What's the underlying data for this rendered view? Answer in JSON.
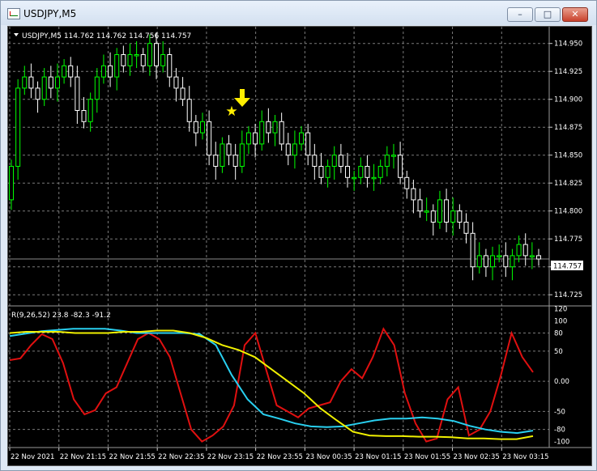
{
  "window": {
    "title": "USDJPY,M5",
    "minimize": "–",
    "maximize": "□",
    "close": "✕"
  },
  "main_panel": {
    "header": "USDJPY,M5  114.762 114.762 114.756 114.757",
    "price_labels": [
      "114.950",
      "114.925",
      "114.900",
      "114.875",
      "114.850",
      "114.825",
      "114.800",
      "114.775",
      "114.750",
      "114.725"
    ],
    "current_price": "114.757",
    "signal_marker": {
      "star": "★",
      "arrow": "down-arrow-icon"
    }
  },
  "indicator_panel": {
    "header": "R(9,26,52) 23.8 -82.3 -91.2",
    "levels": [
      "120",
      "100",
      "80",
      "50",
      "0.00",
      "-50",
      "-80",
      "-100"
    ]
  },
  "time_axis": [
    "22 Nov 2021",
    "22 Nov 21:15",
    "22 Nov 21:55",
    "22 Nov 22:35",
    "22 Nov 23:15",
    "22 Nov 23:55",
    "23 Nov 00:35",
    "23 Nov 01:15",
    "23 Nov 01:55",
    "23 Nov 02:35",
    "23 Nov 03:15"
  ],
  "colors": {
    "background": "#000000",
    "bull": "#00ff00",
    "bear": "#ffffff",
    "grid": "#7a7a7a",
    "line_red": "#e01010",
    "line_cyan": "#29d0f0",
    "line_yellow": "#f0f000",
    "marker": "#ffee00"
  },
  "chart_data": [
    {
      "type": "candlestick",
      "title": "USDJPY,M5",
      "ylim": [
        114.715,
        114.965
      ],
      "close": [
        114.84,
        114.91,
        114.92,
        114.91,
        114.9,
        114.92,
        114.91,
        114.92,
        114.93,
        114.92,
        114.89,
        114.88,
        114.9,
        114.92,
        114.93,
        114.92,
        114.94,
        114.93,
        114.94,
        114.94,
        114.93,
        114.95,
        114.93,
        114.94,
        114.92,
        114.91,
        114.9,
        114.88,
        114.87,
        114.88,
        114.85,
        114.84,
        114.86,
        114.85,
        114.84,
        114.86,
        114.87,
        114.86,
        114.88,
        114.87,
        114.88,
        114.86,
        114.85,
        114.86,
        114.87,
        114.85,
        114.84,
        114.83,
        114.84,
        114.85,
        114.84,
        114.83,
        114.83,
        114.84,
        114.83,
        114.83,
        114.84,
        114.85,
        114.85,
        114.83,
        114.82,
        114.81,
        114.8,
        114.8,
        114.79,
        114.81,
        114.79,
        114.8,
        114.79,
        114.78,
        114.75,
        114.76,
        114.75,
        114.76,
        114.76,
        114.75,
        114.76,
        114.77,
        114.76,
        114.76,
        114.757
      ]
    },
    {
      "type": "line",
      "title": "R(9,26,52)",
      "ylim": [
        -110,
        125
      ],
      "series": [
        {
          "name": "R(9)",
          "values": [
            35,
            38,
            60,
            78,
            70,
            30,
            -30,
            -55,
            -48,
            -20,
            -10,
            30,
            70,
            80,
            70,
            40,
            -20,
            -80,
            -100,
            -90,
            -75,
            -40,
            60,
            80,
            20,
            -40,
            -50,
            -60,
            -45,
            -40,
            -35,
            0,
            20,
            5,
            40,
            87,
            60,
            -20,
            -70,
            -100,
            -95,
            -30,
            -10,
            -90,
            -80,
            -50,
            10,
            80,
            40,
            15
          ]
        },
        {
          "name": "R(26)",
          "values": [
            75,
            79,
            83,
            85,
            87,
            87,
            87,
            84,
            80,
            80,
            80,
            80,
            78,
            60,
            10,
            -30,
            -55,
            -62,
            -70,
            -75,
            -76,
            -75,
            -70,
            -65,
            -62,
            -62,
            -60,
            -62,
            -66,
            -74,
            -80,
            -84,
            -86,
            -82
          ]
        },
        {
          "name": "R(52)",
          "values": [
            80,
            82,
            82,
            82,
            80,
            80,
            80,
            82,
            82,
            84,
            84,
            80,
            72,
            60,
            52,
            40,
            20,
            0,
            -20,
            -45,
            -65,
            -84,
            -90,
            -91,
            -91,
            -92,
            -92,
            -93,
            -95,
            -95,
            -96,
            -96,
            -91
          ]
        }
      ]
    }
  ]
}
